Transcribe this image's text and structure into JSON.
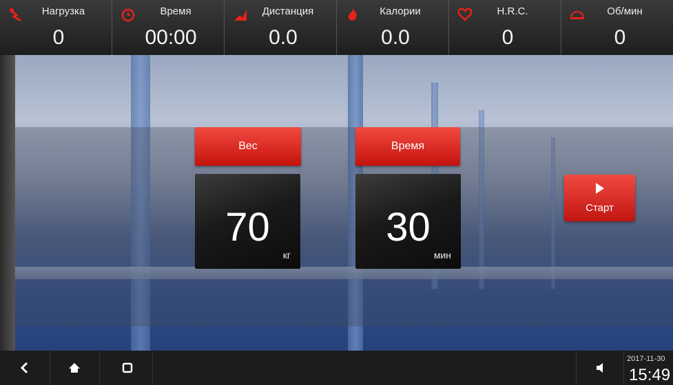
{
  "stats": [
    {
      "label": "Нагрузка",
      "value": "0",
      "icon": "load-icon"
    },
    {
      "label": "Время",
      "value": "00:00",
      "icon": "clock-icon"
    },
    {
      "label": "Дистанция",
      "value": "0.0",
      "icon": "distance-icon"
    },
    {
      "label": "Калории",
      "value": "0.0",
      "icon": "flame-icon"
    },
    {
      "label": "H.R.C.",
      "value": "0",
      "icon": "heart-icon"
    },
    {
      "label": "Об/мин",
      "value": "0",
      "icon": "rpm-icon"
    }
  ],
  "weight": {
    "header": "Вес",
    "value": "70",
    "unit": "кг"
  },
  "time_setting": {
    "header": "Время",
    "value": "30",
    "unit": "мин"
  },
  "start": {
    "label": "Старт"
  },
  "clock": {
    "date": "2017-11-30",
    "time": "15:49"
  },
  "colors": {
    "accent": "#e0221a",
    "icon_red": "#e8221a"
  }
}
